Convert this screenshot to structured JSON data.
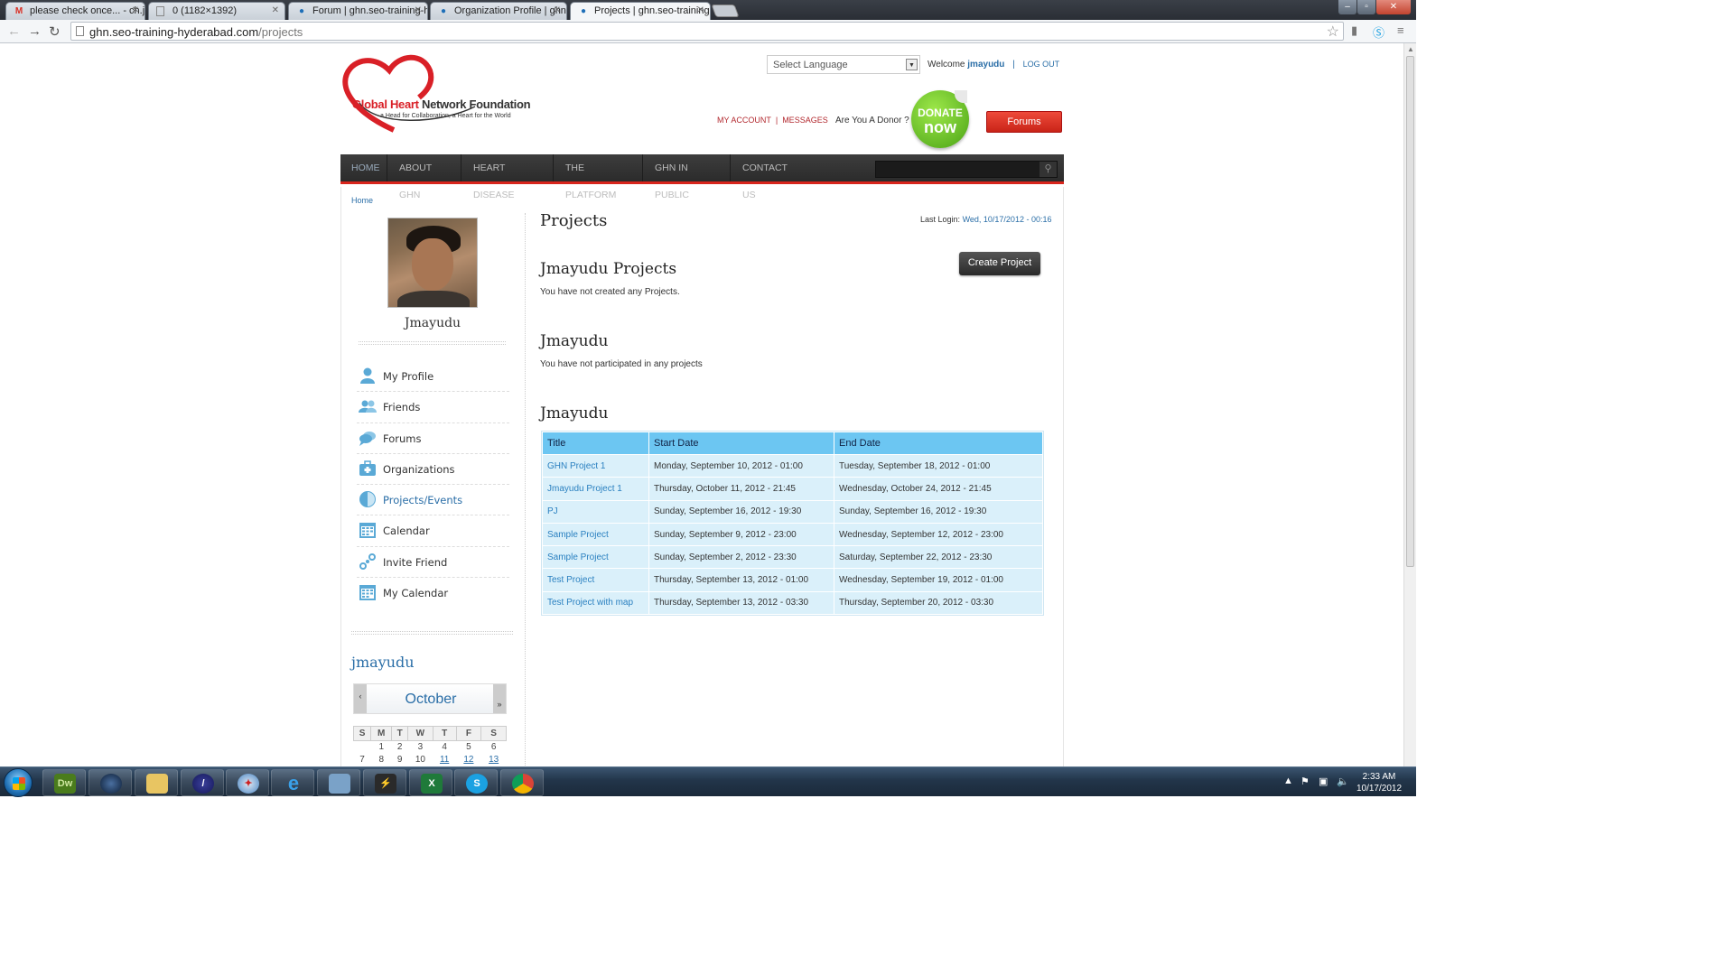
{
  "browser": {
    "tabs": [
      {
        "title": "please check once... - ch.jr",
        "favicon": "gmail-icon"
      },
      {
        "title": "0 (1182×1392)",
        "favicon": "page-icon"
      },
      {
        "title": "Forum | ghn.seo-training-h",
        "favicon": "drupal-icon"
      },
      {
        "title": "Organization Profile | ghn.s",
        "favicon": "drupal-icon"
      },
      {
        "title": "Projects | ghn.seo-training",
        "favicon": "drupal-icon",
        "active": true
      }
    ],
    "url_host": "ghn.seo-training-hyderabad.com",
    "url_path": "/projects"
  },
  "header": {
    "logo_title_red": "Global Heart",
    "logo_title_dark": " Network Foundation",
    "logo_tagline": "a Head for Collaboration, a Heart for the World",
    "language_select": "Select Language",
    "welcome_prefix": "Welcome",
    "username": "jmayudu",
    "logout": "LOG OUT",
    "my_account": "MY ACCOUNT",
    "messages": "MESSAGES",
    "donor_question": "Are You A Donor ?",
    "donate_line1": "DONATE",
    "donate_line2": "now",
    "forums_button": "Forums"
  },
  "nav": {
    "items": [
      "HOME",
      "ABOUT GHN",
      "HEART DISEASE",
      "THE PLATFORM",
      "GHN IN PUBLIC",
      "CONTACT US"
    ]
  },
  "breadcrumb": "Home",
  "sidebar": {
    "profile_name": "Jmayudu",
    "items": [
      {
        "label": "My Profile",
        "icon": "user-icon"
      },
      {
        "label": "Friends",
        "icon": "friends-icon"
      },
      {
        "label": "Forums",
        "icon": "chat-icon"
      },
      {
        "label": "Organizations",
        "icon": "briefcase-icon"
      },
      {
        "label": "Projects/Events",
        "icon": "half-circle-icon",
        "active": true
      },
      {
        "label": "Calendar",
        "icon": "calendar-icon"
      },
      {
        "label": "Invite Friend",
        "icon": "link-icon"
      },
      {
        "label": "My Calendar",
        "icon": "calendar-icon"
      }
    ],
    "calendar": {
      "user": "jmayudu",
      "month": "October",
      "prev": "‹",
      "next": "»",
      "weekdays": [
        "S",
        "M",
        "T",
        "W",
        "T",
        "F",
        "S"
      ],
      "rows": [
        [
          "",
          "1",
          "2",
          "3",
          "4",
          "5",
          "6"
        ],
        [
          "7",
          "8",
          "9",
          "10",
          "11",
          "12",
          "13"
        ]
      ],
      "linked_days": [
        "11",
        "12",
        "13"
      ]
    }
  },
  "main": {
    "title": "Projects",
    "last_login_label": "Last Login:",
    "last_login_value": "Wed, 10/17/2012 - 00:16",
    "create_button": "Create Project",
    "section1_title": "Jmayudu Projects",
    "section1_text": "You have not created any Projects.",
    "section2_title": "Jmayudu",
    "section2_text": "You have not participated in any projects",
    "section3_title": "Jmayudu",
    "table": {
      "headers": [
        "Title",
        "Start Date",
        "End Date"
      ],
      "rows": [
        [
          "GHN Project 1",
          "Monday, September 10, 2012 - 01:00",
          "Tuesday, September 18, 2012 - 01:00"
        ],
        [
          "Jmayudu Project 1",
          "Thursday, October 11, 2012 - 21:45",
          "Wednesday, October 24, 2012 - 21:45"
        ],
        [
          "PJ",
          "Sunday, September 16, 2012 - 19:30",
          "Sunday, September 16, 2012 - 19:30"
        ],
        [
          "Sample Project",
          "Sunday, September 9, 2012 - 23:00",
          "Wednesday, September 12, 2012 - 23:00"
        ],
        [
          "Sample Project",
          "Sunday, September 2, 2012 - 23:30",
          "Saturday, September 22, 2012 - 23:30"
        ],
        [
          "Test Project",
          "Thursday, September 13, 2012 - 01:00",
          "Wednesday, September 19, 2012 - 01:00"
        ],
        [
          "Test Project with map",
          "Thursday, September 13, 2012 - 03:30",
          "Thursday, September 20, 2012 - 03:30"
        ]
      ]
    }
  },
  "taskbar": {
    "apps": [
      "start-orb",
      "dreamweaver-icon",
      "globe-icon",
      "explorer-folder-icon",
      "eclipse-icon",
      "safari-icon",
      "internet-explorer-icon",
      "remote-desktop-icon",
      "winamp-icon",
      "excel-icon",
      "skype-icon",
      "chrome-icon"
    ],
    "time": "2:33 AM",
    "date": "10/17/2012"
  }
}
